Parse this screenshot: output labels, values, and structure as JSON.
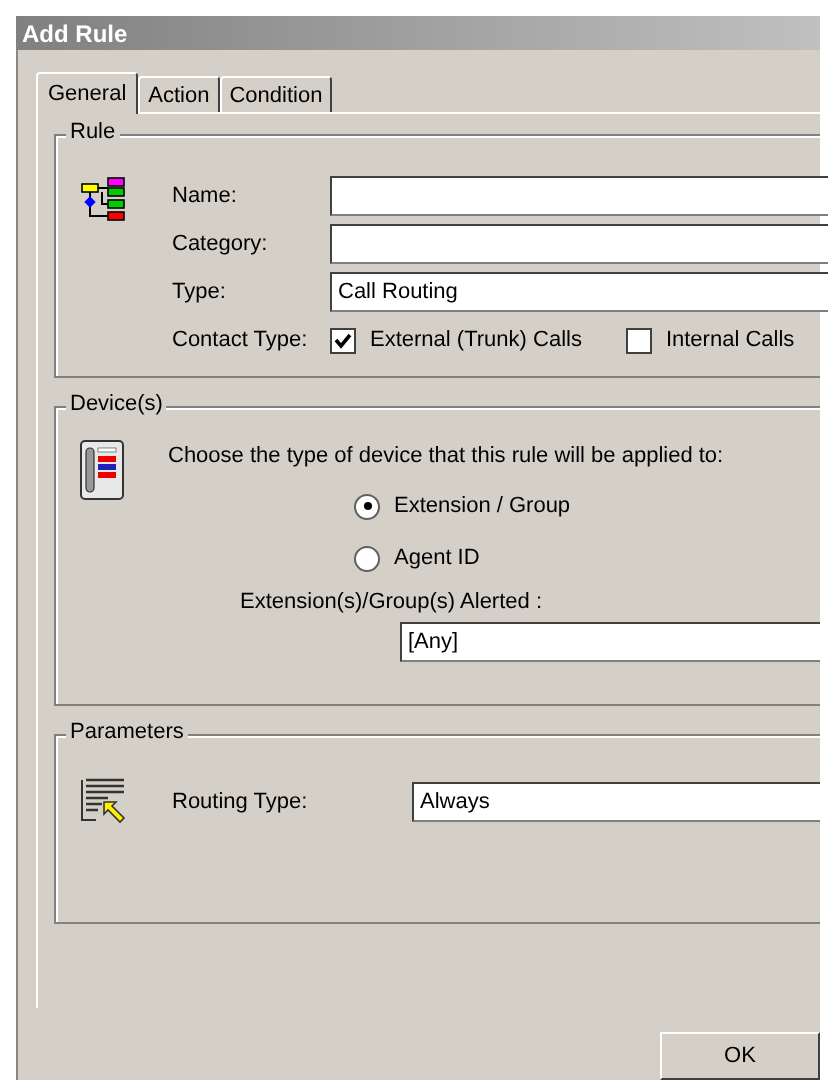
{
  "window": {
    "title": "Add Rule"
  },
  "tabs": [
    {
      "label": "General",
      "selected": true
    },
    {
      "label": "Action",
      "selected": false
    },
    {
      "label": "Condition",
      "selected": false
    }
  ],
  "rule": {
    "title": "Rule",
    "fields": [
      {
        "label": "Name:"
      },
      {
        "label": "Category:"
      },
      {
        "label": "Type:",
        "value": "Call Routing"
      }
    ],
    "contact_type": {
      "label": "Contact Type:",
      "options": [
        {
          "label": "External (Trunk) Calls",
          "checked": true
        },
        {
          "label": "Internal Calls",
          "checked": false
        }
      ]
    }
  },
  "devices": {
    "title": "Device(s)",
    "prompt": "Choose the type of device that this rule will be applied to:",
    "options": [
      {
        "label": "Extension / Group",
        "selected": true
      },
      {
        "label": "Agent ID",
        "selected": false
      }
    ],
    "alerted_label": "Extension(s)/Group(s) Alerted :",
    "alerted_value": "[Any]"
  },
  "parameters": {
    "title": "Parameters",
    "routing_label": "Routing Type:",
    "routing_value": "Always"
  },
  "buttons": [
    "OK"
  ]
}
